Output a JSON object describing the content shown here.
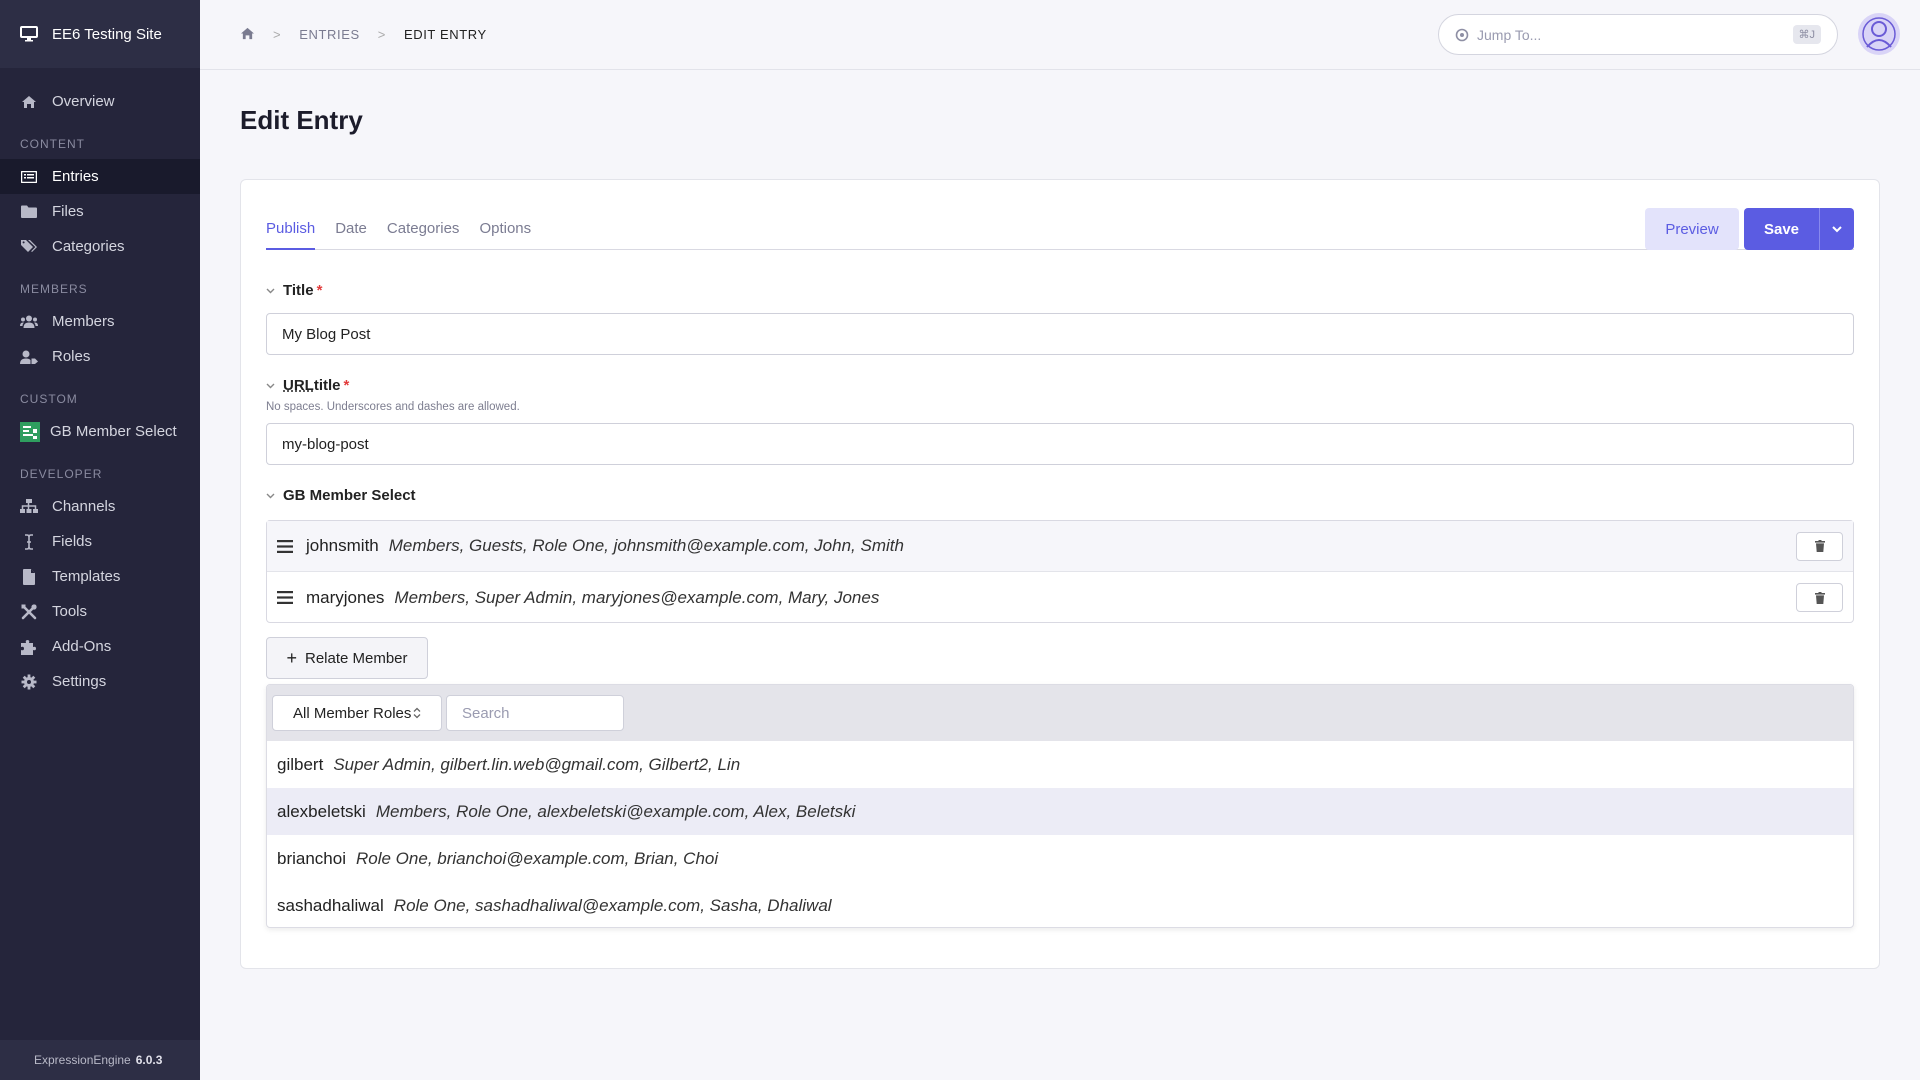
{
  "sidebar": {
    "site_name": "EE6 Testing Site",
    "overview": "Overview",
    "sections": {
      "content": "CONTENT",
      "members": "MEMBERS",
      "custom": "CUSTOM",
      "developer": "DEVELOPER"
    },
    "content_items": [
      "Entries",
      "Files",
      "Categories"
    ],
    "member_items": [
      "Members",
      "Roles"
    ],
    "custom_items": [
      "GB Member Select"
    ],
    "developer_items": [
      "Channels",
      "Fields",
      "Templates",
      "Tools",
      "Add-Ons",
      "Settings"
    ],
    "version_label": "ExpressionEngine",
    "version_number": "6.0.3"
  },
  "topbar": {
    "breadcrumb": [
      "ENTRIES",
      "EDIT ENTRY"
    ],
    "jump_placeholder": "Jump To...",
    "jump_shortcut": "⌘J"
  },
  "page": {
    "title": "Edit Entry"
  },
  "tabs": [
    "Publish",
    "Date",
    "Categories",
    "Options"
  ],
  "actions": {
    "preview": "Preview",
    "save": "Save"
  },
  "fields": {
    "title": {
      "label": "Title",
      "value": "My Blog Post"
    },
    "url_title": {
      "label_abbr": "URL",
      "label_rest": " title",
      "hint": "No spaces. Underscores and dashes are allowed.",
      "value": "my-blog-post"
    },
    "member_select": {
      "label": "GB Member Select"
    }
  },
  "selected_members": [
    {
      "username": "johnsmith",
      "meta": "Members, Guests, Role One, johnsmith@example.com, John, Smith"
    },
    {
      "username": "maryjones",
      "meta": "Members, Super Admin, maryjones@example.com, Mary, Jones"
    }
  ],
  "relate": {
    "button": "Relate Member",
    "role_filter": "All Member Roles",
    "search_placeholder": "Search",
    "options": [
      {
        "username": "gilbert",
        "meta": "Super Admin, gilbert.lin.web@gmail.com, Gilbert2, Lin"
      },
      {
        "username": "alexbeletski",
        "meta": "Members, Role One, alexbeletski@example.com, Alex, Beletski"
      },
      {
        "username": "brianchoi",
        "meta": "Role One, brianchoi@example.com, Brian, Choi"
      },
      {
        "username": "sashadhaliwal",
        "meta": "Role One, sashadhaliwal@example.com, Sasha, Dhaliwal"
      }
    ]
  },
  "colors": {
    "accent": "#5b5ce2",
    "sidebar_bg": "#25253b",
    "required": "#e23b3b"
  }
}
